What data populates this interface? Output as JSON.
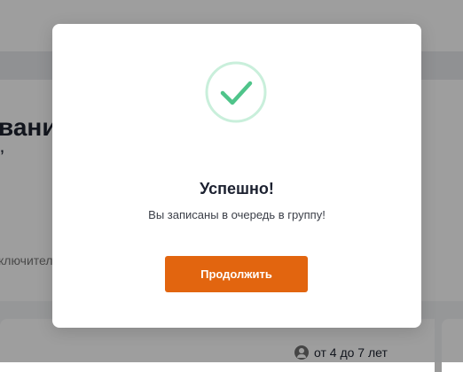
{
  "background": {
    "title_fragment": "вани",
    "quote_fragment": "”",
    "exclusive_fragment": "ключител",
    "age_range": "от 4 до 7 лет"
  },
  "modal": {
    "icon": "check-icon",
    "title": "Успешно!",
    "message": "Вы записаны в очередь в группу!",
    "continue_label": "Продолжить"
  },
  "colors": {
    "accent": "#e2650f",
    "success": "#4fc48a",
    "success_ring": "#c9efdb"
  }
}
